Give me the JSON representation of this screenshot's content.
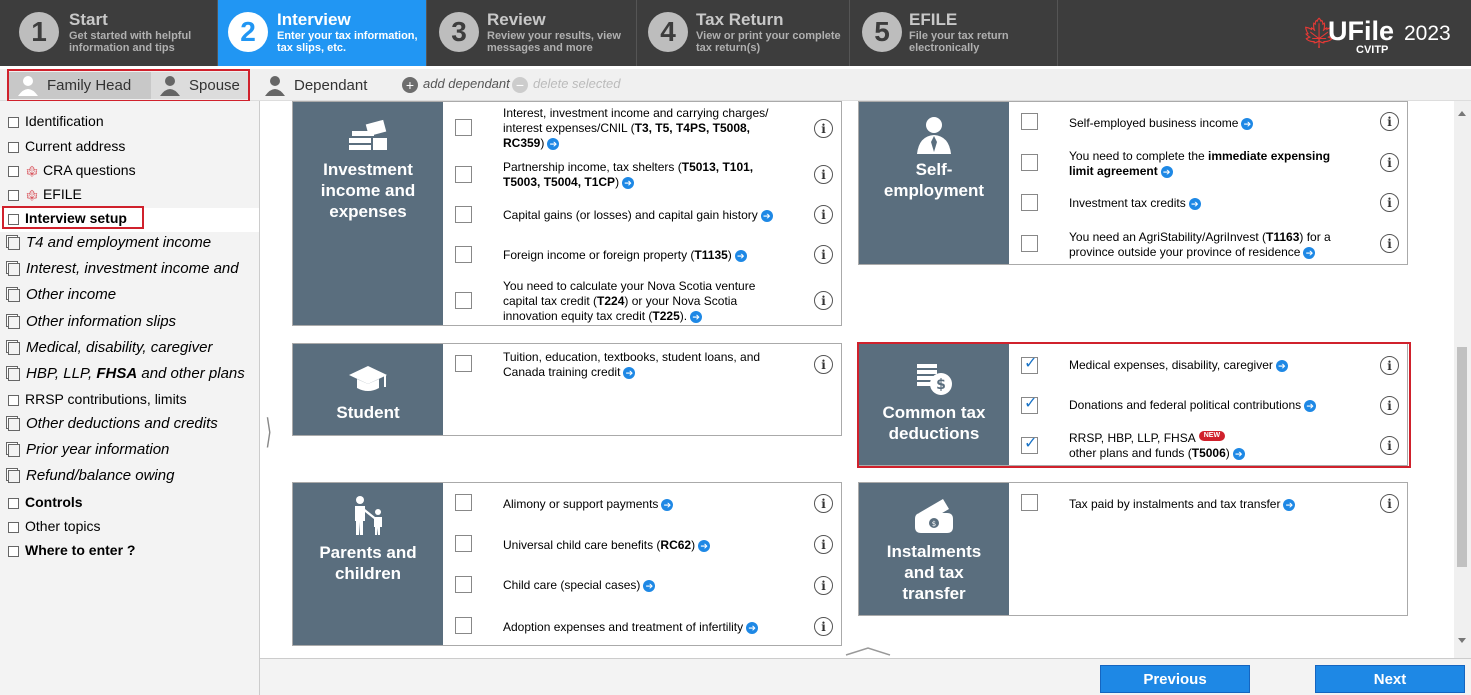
{
  "steps": [
    {
      "num": "1",
      "title": "Start",
      "desc1": "Get started with helpful",
      "desc2": "information and tips",
      "active": false
    },
    {
      "num": "2",
      "title": "Interview",
      "desc1": "Enter your tax information,",
      "desc2": "tax slips, etc.",
      "active": true
    },
    {
      "num": "3",
      "title": "Review",
      "desc1": "Review your results, view",
      "desc2": "messages and more",
      "active": false
    },
    {
      "num": "4",
      "title": "Tax Return",
      "desc1": "View or print your complete",
      "desc2": "tax return(s)",
      "active": false
    },
    {
      "num": "5",
      "title": "EFILE",
      "desc1": "File your tax return",
      "desc2": "electronically",
      "active": false
    }
  ],
  "logo": {
    "brand": "UFile",
    "year": "2023",
    "sub": "CVITP"
  },
  "person_tabs": {
    "family_head": "Family Head",
    "spouse": "Spouse",
    "dependant": "Dependant",
    "add": "add dependant",
    "delete": "delete selected"
  },
  "sidebar": {
    "identification": "Identification",
    "current_address": "Current address",
    "cra_questions": "CRA questions",
    "efile": "EFILE",
    "interview_setup": "Interview setup",
    "t4": "T4 and employment income",
    "interest": "Interest, investment income and",
    "other_income": "Other income",
    "other_info": "Other information slips",
    "medical": "Medical, disability, caregiver",
    "hbp_pre": "HBP, LLP, ",
    "hbp_bold": "FHSA",
    "hbp_post": " and other plans",
    "rrsp": "RRSP contributions, limits",
    "other_deductions": "Other deductions and credits",
    "prior_year": "Prior year information",
    "refund": "Refund/balance owing",
    "controls": "Controls",
    "other_topics": "Other topics",
    "where": "Where to enter ?"
  },
  "investment": {
    "label1": "Investment",
    "label2": "income and",
    "label3": "expenses",
    "o1": {
      "a": "Interest, investment income and carrying charges/",
      "b": "interest expenses/CNIL (",
      "c": "T3, T5, T4PS, T5008,",
      "d": "RC359",
      "e": ")"
    },
    "o2": {
      "a": "Partnership income, tax shelters (",
      "b": "T5013, T101,",
      "c": "T5003, T5004, T1CP",
      "d": ")"
    },
    "o3": "Capital gains (or losses) and capital gain history",
    "o4": {
      "a": "Foreign income or foreign property (",
      "b": "T1135",
      "c": ")"
    },
    "o5": {
      "a": "You need to calculate your Nova Scotia venture",
      "b": "capital tax credit (",
      "c": "T224",
      "d": ") or your Nova Scotia",
      "e": "innovation equity tax credit (",
      "f": "T225",
      "g": ")."
    }
  },
  "self": {
    "label1": "Self-",
    "label2": "employment",
    "o1": "Self-employed business income",
    "o2": {
      "a": "You need to complete the ",
      "b": "immediate expensing",
      "c": "limit agreement"
    },
    "o3": "Investment tax credits",
    "o4": {
      "a": "You need an AgriStability/AgriInvest (",
      "b": "T1163",
      "c": ") for a",
      "d": "province outside your province of residence"
    }
  },
  "student": {
    "label": "Student",
    "o1a": "Tuition, education, textbooks, student loans, and",
    "o1b": "Canada training credit"
  },
  "common": {
    "label1": "Common tax",
    "label2": "deductions",
    "o1": "Medical expenses, disability, caregiver",
    "o2": "Donations and federal political contributions",
    "o3a": "RRSP, HBP, LLP, FHSA",
    "o3new": "NEW",
    "o3b": "other plans and funds (",
    "o3c": "T5006",
    "o3d": ")"
  },
  "parents": {
    "label1": "Parents and",
    "label2": "children",
    "o1": "Alimony or support payments",
    "o2a": "Universal child care benefits (",
    "o2b": "RC62",
    "o2c": ")",
    "o3": "Child care (special cases)",
    "o4": "Adoption expenses and treatment of infertility"
  },
  "instal": {
    "label1": "Instalments",
    "label2": "and tax",
    "label3": "transfer",
    "o1": "Tax paid by instalments and tax transfer"
  },
  "buttons": {
    "previous": "Previous",
    "next": "Next"
  },
  "glyphs": {
    "info": "i",
    "arrow": "➔"
  },
  "colors": {
    "accent": "#2196f3",
    "category": "#5a6e7e",
    "highlight": "#d0212c"
  }
}
